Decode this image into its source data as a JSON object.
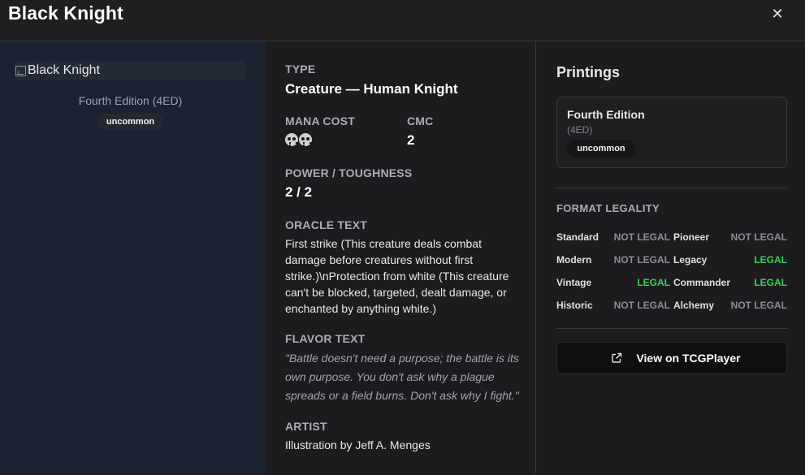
{
  "header": {
    "title": "Black Knight",
    "close_icon": "close-icon"
  },
  "card_image": {
    "alt": "Black Knight",
    "icon": "broken-image-icon"
  },
  "set": {
    "name": "Fourth Edition (4ED)",
    "rarity": "uncommon"
  },
  "details": {
    "type_label": "TYPE",
    "type_value": "Creature — Human Knight",
    "mana_label": "MANA COST",
    "mana_symbols": [
      "black-mana-icon",
      "black-mana-icon"
    ],
    "cmc_label": "CMC",
    "cmc_value": "2",
    "pt_label": "POWER / TOUGHNESS",
    "pt_value": "2 / 2",
    "oracle_label": "ORACLE TEXT",
    "oracle_text": "First strike (This creature deals combat damage before creatures without first strike.)\\nProtection from white (This creature can't be blocked, targeted, dealt damage, or enchanted by anything white.)",
    "flavor_label": "FLAVOR TEXT",
    "flavor_text": "\"Battle doesn't need a purpose; the battle is its own purpose. You don't ask why a plague spreads or a field burns. Don't ask why I fight.\"",
    "artist_label": "ARTIST",
    "artist_text": "Illustration by Jeff A. Menges"
  },
  "printings": {
    "heading": "Printings",
    "items": [
      {
        "name": "Fourth Edition",
        "code": "(4ED)",
        "rarity": "uncommon"
      }
    ]
  },
  "legality": {
    "heading": "FORMAT LEGALITY",
    "formats": [
      {
        "name": "Standard",
        "status": "NOT LEGAL",
        "legal": false
      },
      {
        "name": "Pioneer",
        "status": "NOT LEGAL",
        "legal": false
      },
      {
        "name": "Modern",
        "status": "NOT LEGAL",
        "legal": false
      },
      {
        "name": "Legacy",
        "status": "LEGAL",
        "legal": true
      },
      {
        "name": "Vintage",
        "status": "LEGAL",
        "legal": true
      },
      {
        "name": "Commander",
        "status": "LEGAL",
        "legal": true
      },
      {
        "name": "Historic",
        "status": "NOT LEGAL",
        "legal": false
      },
      {
        "name": "Alchemy",
        "status": "NOT LEGAL",
        "legal": false
      }
    ],
    "colors": {
      "legal": "#3ecf5a",
      "not_legal": "#8a8f96"
    }
  },
  "actions": {
    "tcg_label": "View on TCGPlayer",
    "tcg_icon": "external-link-icon"
  }
}
